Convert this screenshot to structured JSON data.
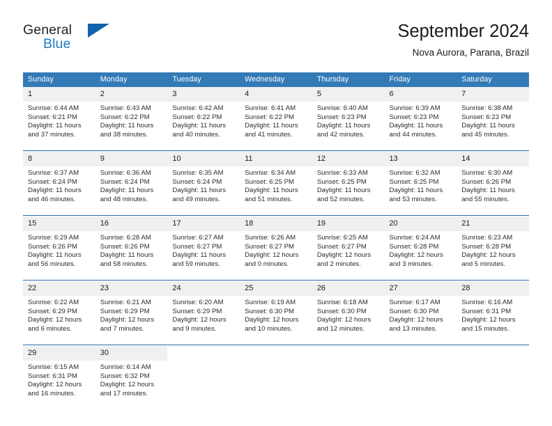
{
  "brand": {
    "name_part1": "General",
    "name_part2": "Blue",
    "triangle_icon": "triangle-icon",
    "color_dark": "#20242a",
    "color_blue": "#1f7ac4",
    "color_triangle": "#1162aa"
  },
  "header": {
    "title": "September 2024",
    "subtitle": "Nova Aurora, Parana, Brazil",
    "accent_color": "#337ab7"
  },
  "calendar": {
    "weekday_headers": [
      "Sunday",
      "Monday",
      "Tuesday",
      "Wednesday",
      "Thursday",
      "Friday",
      "Saturday"
    ],
    "weeks": [
      [
        {
          "day": "1",
          "sunrise": "Sunrise: 6:44 AM",
          "sunset": "Sunset: 6:21 PM",
          "daylight1": "Daylight: 11 hours",
          "daylight2": "and 37 minutes."
        },
        {
          "day": "2",
          "sunrise": "Sunrise: 6:43 AM",
          "sunset": "Sunset: 6:22 PM",
          "daylight1": "Daylight: 11 hours",
          "daylight2": "and 38 minutes."
        },
        {
          "day": "3",
          "sunrise": "Sunrise: 6:42 AM",
          "sunset": "Sunset: 6:22 PM",
          "daylight1": "Daylight: 11 hours",
          "daylight2": "and 40 minutes."
        },
        {
          "day": "4",
          "sunrise": "Sunrise: 6:41 AM",
          "sunset": "Sunset: 6:22 PM",
          "daylight1": "Daylight: 11 hours",
          "daylight2": "and 41 minutes."
        },
        {
          "day": "5",
          "sunrise": "Sunrise: 6:40 AM",
          "sunset": "Sunset: 6:23 PM",
          "daylight1": "Daylight: 11 hours",
          "daylight2": "and 42 minutes."
        },
        {
          "day": "6",
          "sunrise": "Sunrise: 6:39 AM",
          "sunset": "Sunset: 6:23 PM",
          "daylight1": "Daylight: 11 hours",
          "daylight2": "and 44 minutes."
        },
        {
          "day": "7",
          "sunrise": "Sunrise: 6:38 AM",
          "sunset": "Sunset: 6:23 PM",
          "daylight1": "Daylight: 11 hours",
          "daylight2": "and 45 minutes."
        }
      ],
      [
        {
          "day": "8",
          "sunrise": "Sunrise: 6:37 AM",
          "sunset": "Sunset: 6:24 PM",
          "daylight1": "Daylight: 11 hours",
          "daylight2": "and 46 minutes."
        },
        {
          "day": "9",
          "sunrise": "Sunrise: 6:36 AM",
          "sunset": "Sunset: 6:24 PM",
          "daylight1": "Daylight: 11 hours",
          "daylight2": "and 48 minutes."
        },
        {
          "day": "10",
          "sunrise": "Sunrise: 6:35 AM",
          "sunset": "Sunset: 6:24 PM",
          "daylight1": "Daylight: 11 hours",
          "daylight2": "and 49 minutes."
        },
        {
          "day": "11",
          "sunrise": "Sunrise: 6:34 AM",
          "sunset": "Sunset: 6:25 PM",
          "daylight1": "Daylight: 11 hours",
          "daylight2": "and 51 minutes."
        },
        {
          "day": "12",
          "sunrise": "Sunrise: 6:33 AM",
          "sunset": "Sunset: 6:25 PM",
          "daylight1": "Daylight: 11 hours",
          "daylight2": "and 52 minutes."
        },
        {
          "day": "13",
          "sunrise": "Sunrise: 6:32 AM",
          "sunset": "Sunset: 6:25 PM",
          "daylight1": "Daylight: 11 hours",
          "daylight2": "and 53 minutes."
        },
        {
          "day": "14",
          "sunrise": "Sunrise: 6:30 AM",
          "sunset": "Sunset: 6:26 PM",
          "daylight1": "Daylight: 11 hours",
          "daylight2": "and 55 minutes."
        }
      ],
      [
        {
          "day": "15",
          "sunrise": "Sunrise: 6:29 AM",
          "sunset": "Sunset: 6:26 PM",
          "daylight1": "Daylight: 11 hours",
          "daylight2": "and 56 minutes."
        },
        {
          "day": "16",
          "sunrise": "Sunrise: 6:28 AM",
          "sunset": "Sunset: 6:26 PM",
          "daylight1": "Daylight: 11 hours",
          "daylight2": "and 58 minutes."
        },
        {
          "day": "17",
          "sunrise": "Sunrise: 6:27 AM",
          "sunset": "Sunset: 6:27 PM",
          "daylight1": "Daylight: 11 hours",
          "daylight2": "and 59 minutes."
        },
        {
          "day": "18",
          "sunrise": "Sunrise: 6:26 AM",
          "sunset": "Sunset: 6:27 PM",
          "daylight1": "Daylight: 12 hours",
          "daylight2": "and 0 minutes."
        },
        {
          "day": "19",
          "sunrise": "Sunrise: 6:25 AM",
          "sunset": "Sunset: 6:27 PM",
          "daylight1": "Daylight: 12 hours",
          "daylight2": "and 2 minutes."
        },
        {
          "day": "20",
          "sunrise": "Sunrise: 6:24 AM",
          "sunset": "Sunset: 6:28 PM",
          "daylight1": "Daylight: 12 hours",
          "daylight2": "and 3 minutes."
        },
        {
          "day": "21",
          "sunrise": "Sunrise: 6:23 AM",
          "sunset": "Sunset: 6:28 PM",
          "daylight1": "Daylight: 12 hours",
          "daylight2": "and 5 minutes."
        }
      ],
      [
        {
          "day": "22",
          "sunrise": "Sunrise: 6:22 AM",
          "sunset": "Sunset: 6:29 PM",
          "daylight1": "Daylight: 12 hours",
          "daylight2": "and 6 minutes."
        },
        {
          "day": "23",
          "sunrise": "Sunrise: 6:21 AM",
          "sunset": "Sunset: 6:29 PM",
          "daylight1": "Daylight: 12 hours",
          "daylight2": "and 7 minutes."
        },
        {
          "day": "24",
          "sunrise": "Sunrise: 6:20 AM",
          "sunset": "Sunset: 6:29 PM",
          "daylight1": "Daylight: 12 hours",
          "daylight2": "and 9 minutes."
        },
        {
          "day": "25",
          "sunrise": "Sunrise: 6:19 AM",
          "sunset": "Sunset: 6:30 PM",
          "daylight1": "Daylight: 12 hours",
          "daylight2": "and 10 minutes."
        },
        {
          "day": "26",
          "sunrise": "Sunrise: 6:18 AM",
          "sunset": "Sunset: 6:30 PM",
          "daylight1": "Daylight: 12 hours",
          "daylight2": "and 12 minutes."
        },
        {
          "day": "27",
          "sunrise": "Sunrise: 6:17 AM",
          "sunset": "Sunset: 6:30 PM",
          "daylight1": "Daylight: 12 hours",
          "daylight2": "and 13 minutes."
        },
        {
          "day": "28",
          "sunrise": "Sunrise: 6:16 AM",
          "sunset": "Sunset: 6:31 PM",
          "daylight1": "Daylight: 12 hours",
          "daylight2": "and 15 minutes."
        }
      ],
      [
        {
          "day": "29",
          "sunrise": "Sunrise: 6:15 AM",
          "sunset": "Sunset: 6:31 PM",
          "daylight1": "Daylight: 12 hours",
          "daylight2": "and 16 minutes."
        },
        {
          "day": "30",
          "sunrise": "Sunrise: 6:14 AM",
          "sunset": "Sunset: 6:32 PM",
          "daylight1": "Daylight: 12 hours",
          "daylight2": "and 17 minutes."
        },
        {
          "day": "",
          "sunrise": "",
          "sunset": "",
          "daylight1": "",
          "daylight2": ""
        },
        {
          "day": "",
          "sunrise": "",
          "sunset": "",
          "daylight1": "",
          "daylight2": ""
        },
        {
          "day": "",
          "sunrise": "",
          "sunset": "",
          "daylight1": "",
          "daylight2": ""
        },
        {
          "day": "",
          "sunrise": "",
          "sunset": "",
          "daylight1": "",
          "daylight2": ""
        },
        {
          "day": "",
          "sunrise": "",
          "sunset": "",
          "daylight1": "",
          "daylight2": ""
        }
      ]
    ]
  }
}
